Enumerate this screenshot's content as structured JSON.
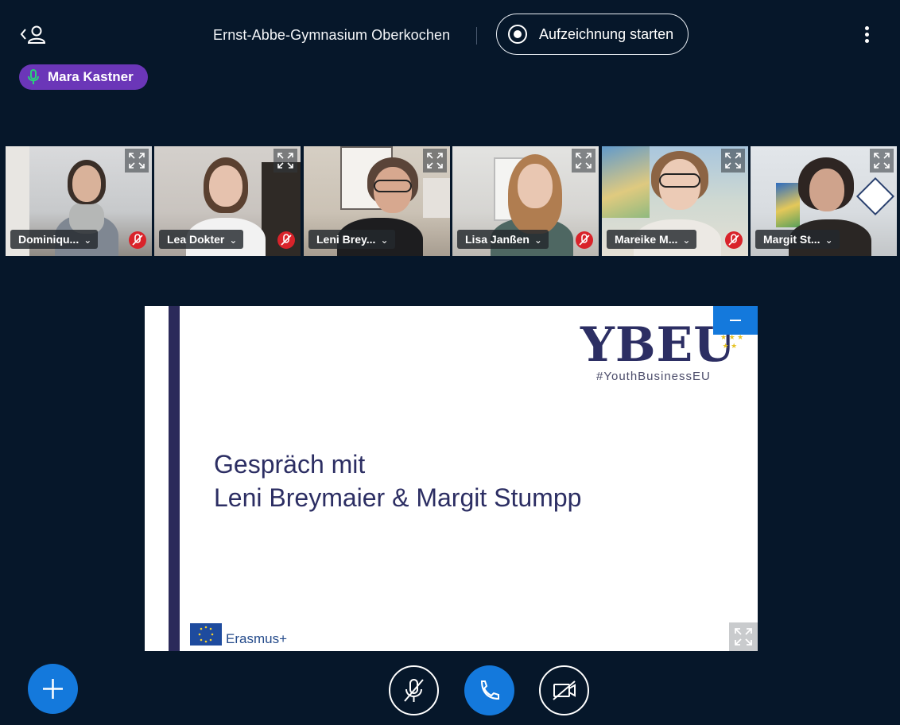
{
  "header": {
    "meeting_title": "Ernst-Abbe-Gymnasium Oberkochen",
    "record_label": "Aufzeichnung starten",
    "users_icon": "users-toggle-icon",
    "options_icon": "more-options-icon"
  },
  "talking_indicator": {
    "name": "Mara Kastner",
    "color": "#6b36b8"
  },
  "participants": [
    {
      "name": "Dominiqu...",
      "muted": true
    },
    {
      "name": "Lea Dokter",
      "muted": true
    },
    {
      "name": "Leni Brey...",
      "muted": false
    },
    {
      "name": "Lisa Janßen",
      "muted": true
    },
    {
      "name": "Mareike M...",
      "muted": true
    },
    {
      "name": "Margit St...",
      "muted": false
    }
  ],
  "presentation": {
    "logo": "YBEU",
    "hashtag": "#YouthBusinessEU",
    "title_line1": "Gespräch mit",
    "title_line2": "Leni Breymaier & Margit Stumpp",
    "footer_logo": "Erasmus+"
  },
  "controls": {
    "actions": "plus-icon",
    "mic": "mic-muted-icon",
    "leave": "phone-icon",
    "camera": "camera-off-icon"
  },
  "colors": {
    "background": "#06172a",
    "accent": "#1479dc",
    "muted": "#d9232a"
  }
}
